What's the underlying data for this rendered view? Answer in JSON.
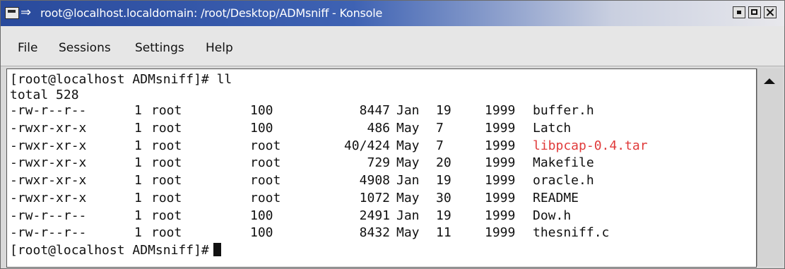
{
  "window": {
    "title": "root@localhost.localdomain: /root/Desktop/ADMsniff - Konsole"
  },
  "menu": [
    "File",
    "Sessions",
    "Settings",
    "Help"
  ],
  "terminal": {
    "prompt_cmd": "[root@localhost ADMsniff]# ll",
    "total": "total 528",
    "rows": [
      {
        "perm": "-rw-r--r--",
        "links": "1",
        "owner": "root",
        "group": "100",
        "size": "8447",
        "month": "Jan",
        "day": "19",
        "year": "1999",
        "name": "buffer.h",
        "color": "normal"
      },
      {
        "perm": "-rwxr-xr-x",
        "links": "1",
        "owner": "root",
        "group": "100",
        "size": "486",
        "month": "May",
        "day": "7",
        "year": "1999",
        "name": "Latch",
        "color": "normal"
      },
      {
        "perm": "-rwxr-xr-x",
        "links": "1",
        "owner": "root",
        "group": "root",
        "size": "40/424",
        "month": "May",
        "day": "7",
        "year": "1999",
        "name": "libpcap-0.4.tar",
        "color": "red"
      },
      {
        "perm": "-rwxr-xr-x",
        "links": "1",
        "owner": "root",
        "group": "root",
        "size": "729",
        "month": "May",
        "day": "20",
        "year": "1999",
        "name": "Makefile",
        "color": "normal"
      },
      {
        "perm": "-rwxr-xr-x",
        "links": "1",
        "owner": "root",
        "group": "root",
        "size": "4908",
        "month": "Jan",
        "day": "19",
        "year": "1999",
        "name": "oracle.h",
        "color": "normal"
      },
      {
        "perm": "-rwxr-xr-x",
        "links": "1",
        "owner": "root",
        "group": "root",
        "size": "1072",
        "month": "May",
        "day": "30",
        "year": "1999",
        "name": "README",
        "color": "normal"
      },
      {
        "perm": "-rw-r--r--",
        "links": "1",
        "owner": "root",
        "group": "100",
        "size": "2491",
        "month": "Jan",
        "day": "19",
        "year": "1999",
        "name": "Dow.h",
        "color": "normal"
      },
      {
        "perm": "-rw-r--r--",
        "links": "1",
        "owner": "root",
        "group": "100",
        "size": "8432",
        "month": "May",
        "day": "11",
        "year": "1999",
        "name": "thesniff.c",
        "color": "normal"
      }
    ],
    "final_prompt": "[root@localhost ADMsniff]#"
  }
}
